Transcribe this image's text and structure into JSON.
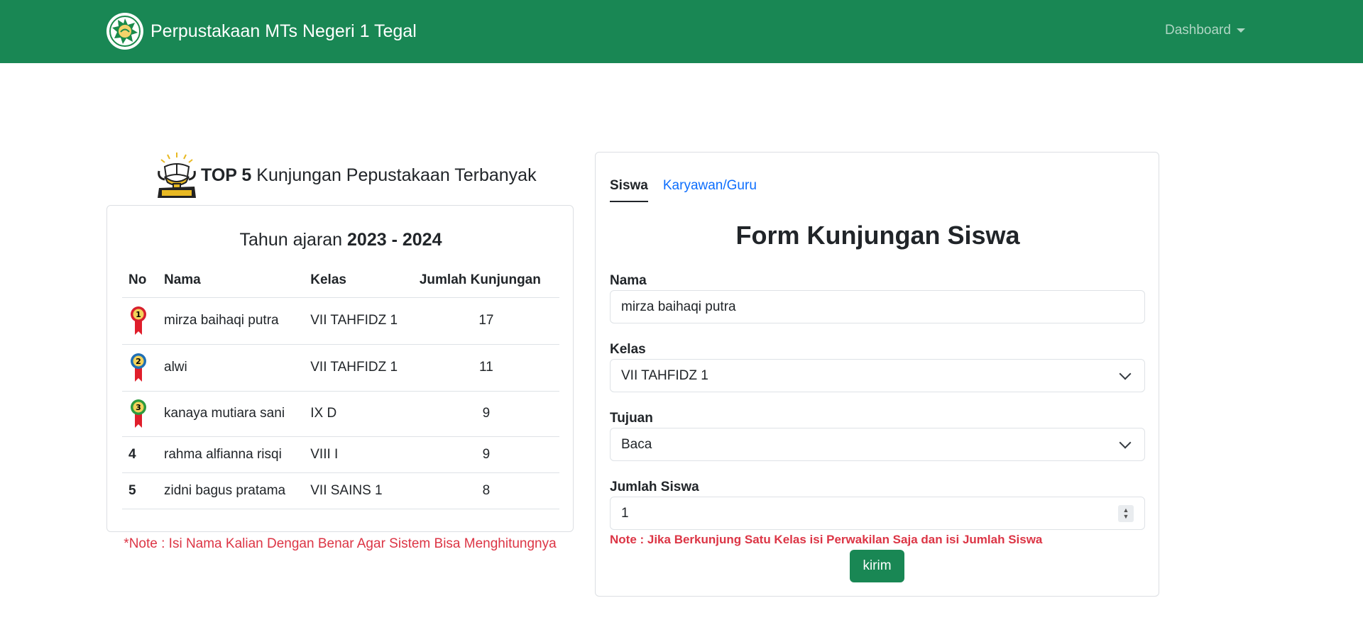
{
  "header": {
    "title": "Perpustakaan MTs Negeri 1 Tegal",
    "menu_label": "Dashboard",
    "brand_color": "#198754"
  },
  "ranking": {
    "title_bold": "TOP 5",
    "title_rest": " Kunjungan Pepustakaan Terbanyak",
    "year_prefix": "Tahun ajaran ",
    "year_value": "2023 - 2024",
    "columns": [
      "No",
      "Nama",
      "Kelas",
      "Jumlah Kunjungan"
    ],
    "rows": [
      {
        "no": "1",
        "nama": "mirza baihaqi putra",
        "kelas": "VII TAHFIDZ 1",
        "jumlah": "17"
      },
      {
        "no": "2",
        "nama": "alwi",
        "kelas": "VII TAHFIDZ 1",
        "jumlah": "11"
      },
      {
        "no": "3",
        "nama": "kanaya mutiara sani",
        "kelas": "IX D",
        "jumlah": "9"
      },
      {
        "no": "4",
        "nama": "rahma alfianna risqi",
        "kelas": "VIII I",
        "jumlah": "9"
      },
      {
        "no": "5",
        "nama": "zidni bagus pratama",
        "kelas": "VII SAINS 1",
        "jumlah": "8"
      }
    ],
    "note": "*Note : Isi Nama Kalian Dengan Benar Agar Sistem Bisa Menghitungnya"
  },
  "form": {
    "tabs": [
      "Siswa",
      "Karyawan/Guru"
    ],
    "title": "Form Kunjungan Siswa",
    "nama_label": "Nama",
    "nama_value": "mirza baihaqi putra",
    "kelas_label": "Kelas",
    "kelas_value": "VII TAHFIDZ 1",
    "tujuan_label": "Tujuan",
    "tujuan_value": "Baca",
    "jumlah_label": "Jumlah Siswa",
    "jumlah_value": "1",
    "note": "Note : Jika Berkunjung Satu Kelas isi Perwakilan Saja dan isi Jumlah Siswa",
    "submit_label": "kirim"
  },
  "icons": {
    "logo": "school-logo-icon",
    "trophy": "reading-champion-trophy-icon",
    "medal": "rank-medal-icon"
  }
}
